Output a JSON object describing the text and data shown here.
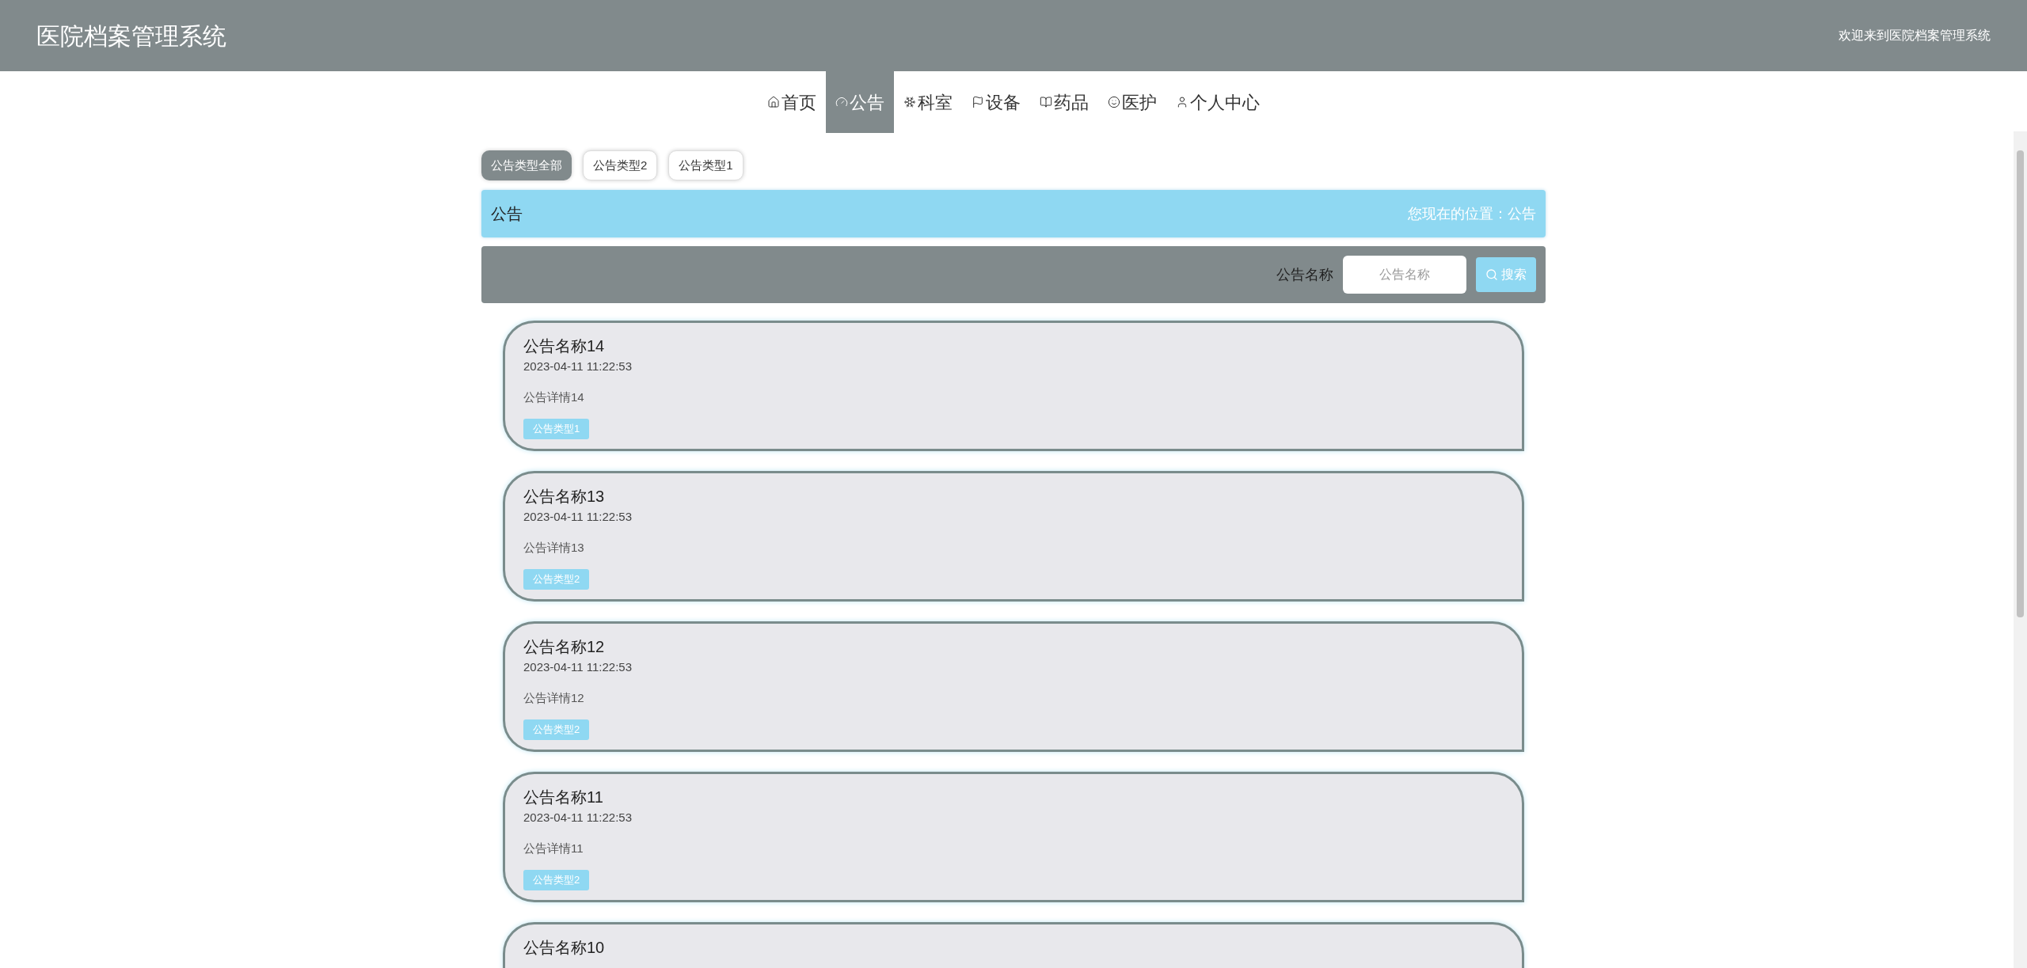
{
  "header": {
    "title": "医院档案管理系统",
    "welcome": "欢迎来到医院档案管理系统"
  },
  "nav": [
    {
      "label": "首页",
      "kind": "home",
      "selected": false
    },
    {
      "label": "公告",
      "kind": "notice",
      "selected": true
    },
    {
      "label": "科室",
      "kind": "department",
      "selected": false
    },
    {
      "label": "设备",
      "kind": "equipment",
      "selected": false
    },
    {
      "label": "药品",
      "kind": "medicine",
      "selected": false
    },
    {
      "label": "医护",
      "kind": "staff",
      "selected": false
    },
    {
      "label": "个人中心",
      "kind": "profile",
      "selected": false
    }
  ],
  "filters": [
    {
      "label": "公告类型全部",
      "selected": true
    },
    {
      "label": "公告类型2",
      "selected": false
    },
    {
      "label": "公告类型1",
      "selected": false
    }
  ],
  "breadcrumb_bar": {
    "title": "公告",
    "location": "您现在的位置：公告"
  },
  "search": {
    "label": "公告名称",
    "placeholder": "公告名称",
    "button": "搜索"
  },
  "notices": [
    {
      "title": "公告名称14",
      "time": "2023-04-11 11:22:53",
      "detail": "公告详情14",
      "tag": "公告类型1"
    },
    {
      "title": "公告名称13",
      "time": "2023-04-11 11:22:53",
      "detail": "公告详情13",
      "tag": "公告类型2"
    },
    {
      "title": "公告名称12",
      "time": "2023-04-11 11:22:53",
      "detail": "公告详情12",
      "tag": "公告类型2"
    },
    {
      "title": "公告名称11",
      "time": "2023-04-11 11:22:53",
      "detail": "公告详情11",
      "tag": "公告类型2"
    },
    {
      "title": "公告名称10"
    }
  ]
}
